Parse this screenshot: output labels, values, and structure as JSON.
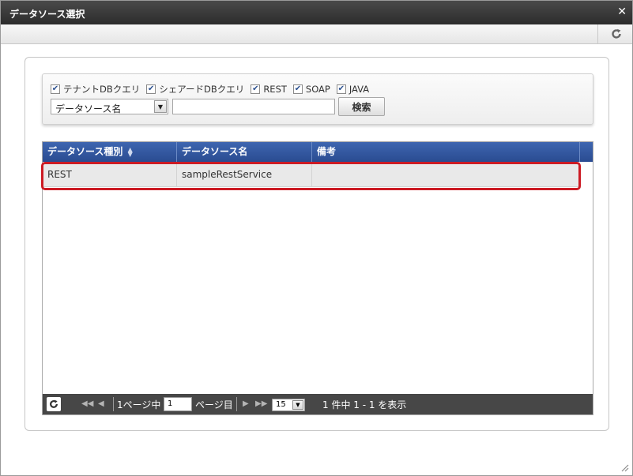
{
  "dialog": {
    "title": "データソース選択"
  },
  "filters": {
    "checkboxes": [
      {
        "label": "テナントDBクエリ",
        "checked": true
      },
      {
        "label": "シェアードDBクエリ",
        "checked": true
      },
      {
        "label": "REST",
        "checked": true
      },
      {
        "label": "SOAP",
        "checked": true
      },
      {
        "label": "JAVA",
        "checked": true
      }
    ],
    "search_field": {
      "selected": "データソース名"
    },
    "search_input": {
      "value": "",
      "placeholder": ""
    },
    "search_button_label": "検索"
  },
  "grid": {
    "columns": [
      "データソース種別",
      "データソース名",
      "備考"
    ],
    "rows": [
      {
        "type": "REST",
        "name": "sampleRestService",
        "note": ""
      }
    ]
  },
  "pager": {
    "page_prefix": "1ページ中",
    "page_value": "1",
    "page_suffix": "ページ目",
    "per_page": "15",
    "summary": "1 件中 1 - 1 を表示"
  },
  "colors": {
    "header_blue": "#2f53a0",
    "highlight_red": "#cc1b24",
    "titlebar_dark": "#333333"
  }
}
